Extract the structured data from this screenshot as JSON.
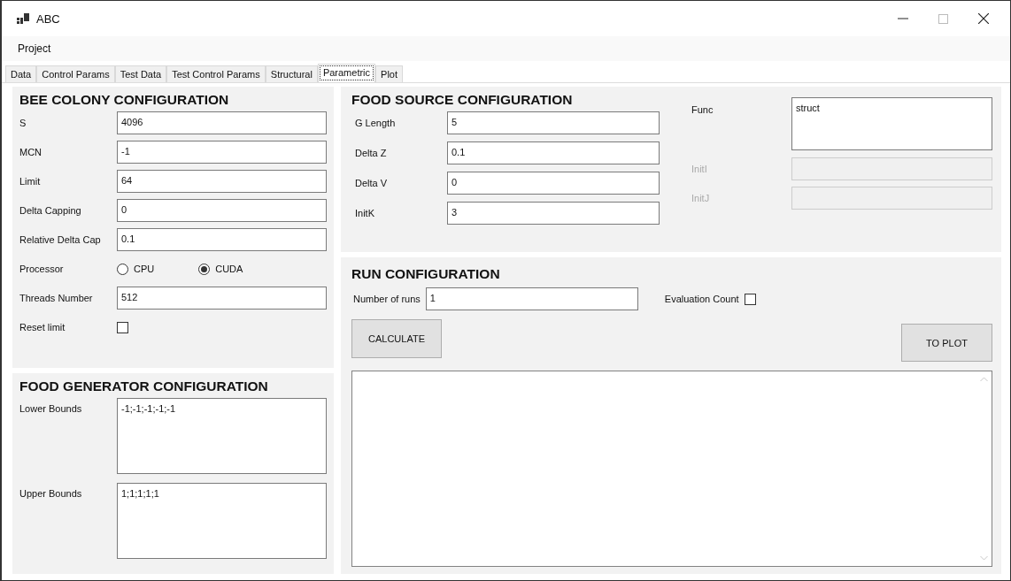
{
  "window": {
    "title": "ABC"
  },
  "menu": [
    "Project"
  ],
  "tabs": [
    {
      "label": "Data",
      "selected": false
    },
    {
      "label": "Control Params",
      "selected": false
    },
    {
      "label": "Test Data",
      "selected": false
    },
    {
      "label": "Test Control Params",
      "selected": false
    },
    {
      "label": "Structural",
      "selected": false
    },
    {
      "label": "Parametric",
      "selected": true
    },
    {
      "label": "Plot",
      "selected": false
    }
  ],
  "bee_colony": {
    "title": "BEE COLONY CONFIGURATION",
    "rows": [
      {
        "kind": "field",
        "label": "S",
        "value": "4096"
      },
      {
        "kind": "field",
        "label": "MCN",
        "value": "-1"
      },
      {
        "kind": "field",
        "label": "Limit",
        "value": "64"
      },
      {
        "kind": "field",
        "label": "Delta Capping",
        "value": "0"
      },
      {
        "kind": "field",
        "label": "Relative Delta Cap",
        "value": "0.1"
      },
      {
        "kind": "radio",
        "label": "Processor",
        "options": [
          {
            "label": "CPU",
            "selected": false
          },
          {
            "label": "CUDA",
            "selected": true
          }
        ]
      },
      {
        "kind": "field",
        "label": "Threads Number",
        "value": "512"
      },
      {
        "kind": "checkbox",
        "label": "Reset limit",
        "checked": false
      }
    ]
  },
  "food_generator": {
    "title": "FOOD GENERATOR CONFIGURATION",
    "rows": [
      {
        "label": "Lower Bounds",
        "value": "-1;-1;-1;-1;-1"
      },
      {
        "label": "Upper Bounds",
        "value": "1;1;1;1;1"
      }
    ]
  },
  "food_source": {
    "title": "FOOD SOURCE CONFIGURATION",
    "fields": [
      {
        "label": "G Length",
        "value": "5"
      },
      {
        "label": "Delta Z",
        "value": "0.1"
      },
      {
        "label": "Delta V",
        "value": "0"
      },
      {
        "label": "InitK",
        "value": "3"
      }
    ],
    "side_fields": [
      {
        "kind": "textarea",
        "label": "Func",
        "value": "struct",
        "disabled": false
      },
      {
        "kind": "field",
        "label": "InitI",
        "disabled": true
      },
      {
        "kind": "field",
        "label": "InitJ",
        "disabled": true
      }
    ]
  },
  "run": {
    "title": "RUN CONFIGURATION",
    "runs_label": "Number of runs",
    "runs_value": "1",
    "evaluation_label": "Evaluation Count",
    "evaluation_checked": false,
    "calculate_button": "CALCULATE",
    "plot_button": "TO PLOT"
  }
}
